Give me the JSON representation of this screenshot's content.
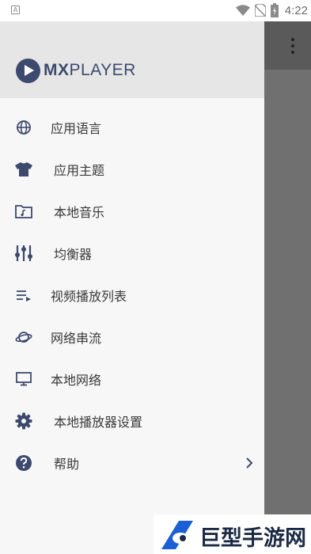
{
  "status_bar": {
    "time": "4:22",
    "notification_icon": "A",
    "icons": [
      "wifi-icon",
      "no-sim-icon",
      "battery-charging-icon"
    ]
  },
  "drawer": {
    "logo": {
      "mx": "MX",
      "player": "PLAYER"
    },
    "items": [
      {
        "label": "应用语言",
        "icon": "globe-icon"
      },
      {
        "label": "应用主题",
        "icon": "tshirt-icon"
      },
      {
        "label": "本地音乐",
        "icon": "music-folder-icon"
      },
      {
        "label": "均衡器",
        "icon": "equalizer-icon"
      },
      {
        "label": "视频播放列表",
        "icon": "playlist-icon"
      },
      {
        "label": "网络串流",
        "icon": "network-stream-icon"
      },
      {
        "label": "本地网络",
        "icon": "monitor-icon"
      },
      {
        "label": "本地播放器设置",
        "icon": "gear-icon"
      },
      {
        "label": "帮助",
        "icon": "help-icon"
      }
    ]
  },
  "watermark": {
    "text": "巨型手游网"
  },
  "colors": {
    "icon": "#3d4a6d",
    "drawer_bg": "#f7f7f8",
    "header_bg": "#e6e6e6",
    "scrim": "#707070"
  }
}
